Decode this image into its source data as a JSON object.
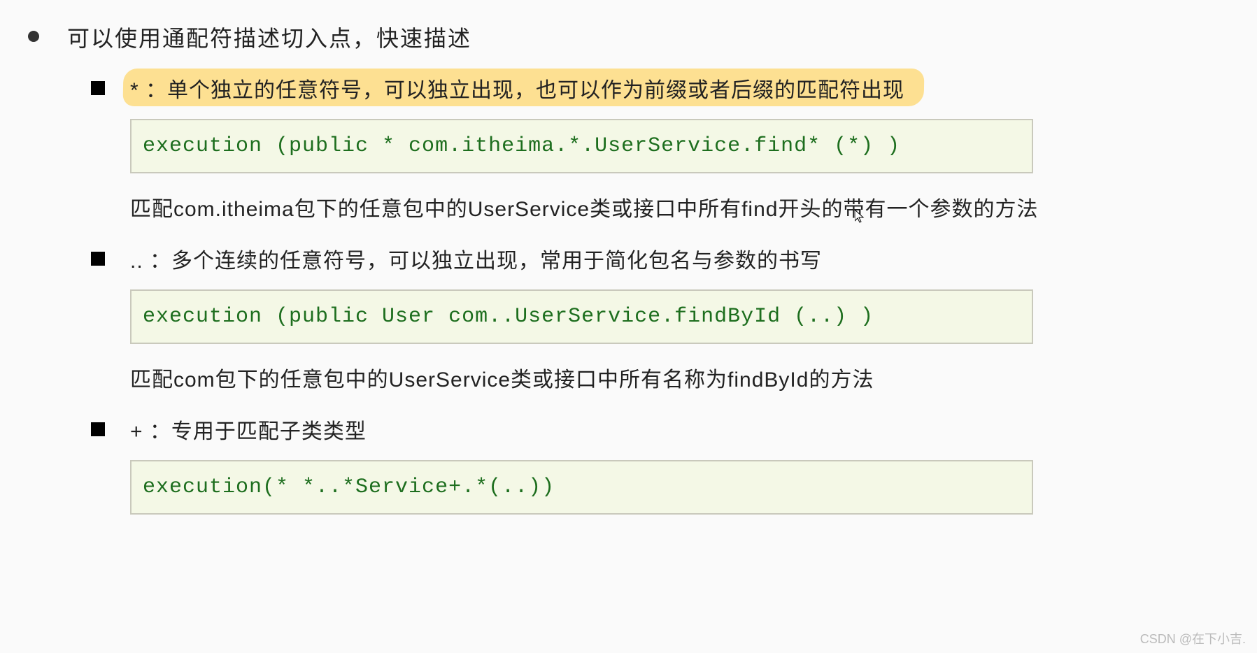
{
  "main": {
    "heading": "可以使用通配符描述切入点，快速描述"
  },
  "items": [
    {
      "title": "* ：单个独立的任意符号，可以独立出现，也可以作为前缀或者后缀的匹配符出现",
      "code": "execution (public * com.itheima.*.UserService.find* (*) )",
      "description": "匹配com.itheima包下的任意包中的UserService类或接口中所有find开头的带有一个参数的方法"
    },
    {
      "title": ".. ：多个连续的任意符号，可以独立出现，常用于简化包名与参数的书写",
      "code": "execution (public User com..UserService.findById (..) )",
      "description": "匹配com包下的任意包中的UserService类或接口中所有名称为findById的方法"
    },
    {
      "title": "+ ：专用于匹配子类类型",
      "code": "execution(* *..*Service+.*(..))",
      "description": ""
    }
  ],
  "watermark": "CSDN @在下小吉."
}
